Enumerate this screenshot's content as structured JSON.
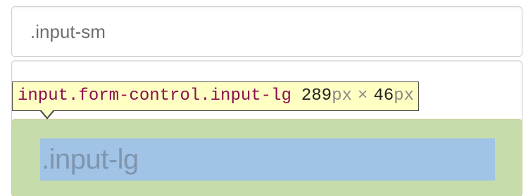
{
  "inputs": {
    "small": {
      "value": ".input-sm"
    },
    "default": {
      "value": ""
    },
    "large": {
      "value": ".input-lg"
    }
  },
  "inspector_tooltip": {
    "selector": "input.form-control.input-lg",
    "width": "289",
    "height": "46",
    "unit": "px",
    "times": "×"
  },
  "colors": {
    "padding_highlight": "#c6dcaa",
    "content_highlight": "#a0c3e6",
    "tooltip_background": "#ffffc4",
    "selector_color": "#8a0f4e"
  }
}
